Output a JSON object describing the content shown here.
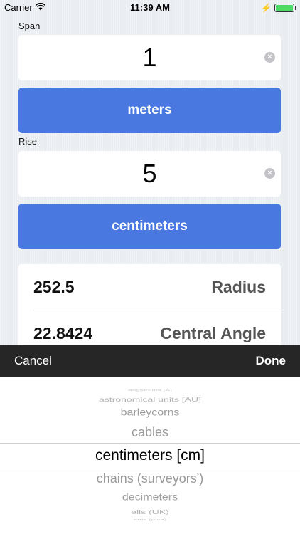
{
  "status_bar": {
    "carrier": "Carrier",
    "time": "11:39 AM"
  },
  "span": {
    "label": "Span",
    "value": "1",
    "unit": "meters"
  },
  "rise": {
    "label": "Rise",
    "value": "5",
    "unit": "centimeters"
  },
  "results": [
    {
      "value": "252.5",
      "label": "Radius"
    },
    {
      "value": "22.8424",
      "label": "Central Angle"
    }
  ],
  "picker_toolbar": {
    "cancel": "Cancel",
    "done": "Done"
  },
  "picker": {
    "items": [
      "angstroms [Å]",
      "astronomical units [AU]",
      "barleycorns",
      "cables",
      "centimeters [cm]",
      "chains (surveyors')",
      "decimeters",
      "ells (UK)",
      "ems (pica)"
    ],
    "selected": "centimeters [cm]"
  }
}
